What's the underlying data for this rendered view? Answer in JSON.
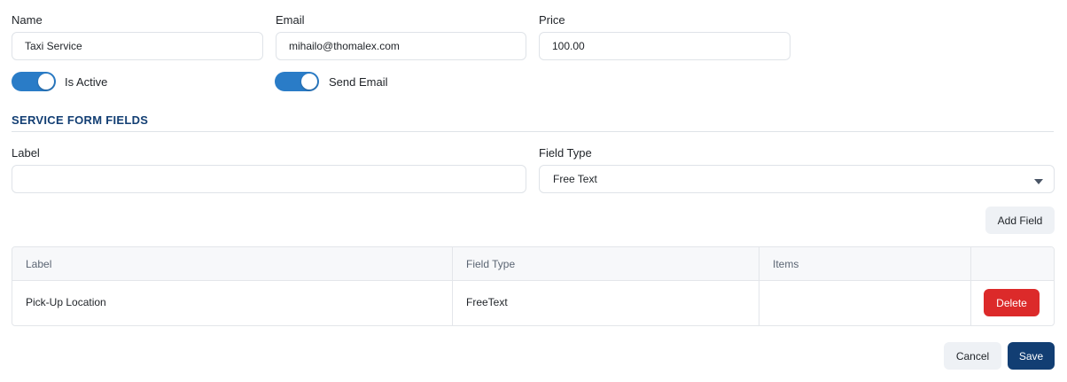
{
  "form": {
    "name_label": "Name",
    "name_value": "Taxi Service",
    "email_label": "Email",
    "email_value": "mihailo@thomalex.com",
    "price_label": "Price",
    "price_value": "100.00",
    "is_active_label": "Is Active",
    "is_active_on": true,
    "send_email_label": "Send Email",
    "send_email_on": true
  },
  "section": {
    "title": "SERVICE FORM FIELDS",
    "label_label": "Label",
    "label_value": "",
    "field_type_label": "Field Type",
    "field_type_value": "Free Text",
    "add_field_label": "Add Field"
  },
  "table": {
    "headers": [
      "Label",
      "Field Type",
      "Items",
      ""
    ],
    "rows": [
      {
        "label": "Pick-Up Location",
        "field_type": "FreeText",
        "items": "",
        "delete_label": "Delete"
      }
    ]
  },
  "actions": {
    "cancel_label": "Cancel",
    "save_label": "Save"
  },
  "colors": {
    "accent": "#2a7cc7",
    "primary": "#123e73",
    "danger": "#dc2a2a"
  },
  "icons": {
    "select_caret": "chevron-down-icon"
  }
}
